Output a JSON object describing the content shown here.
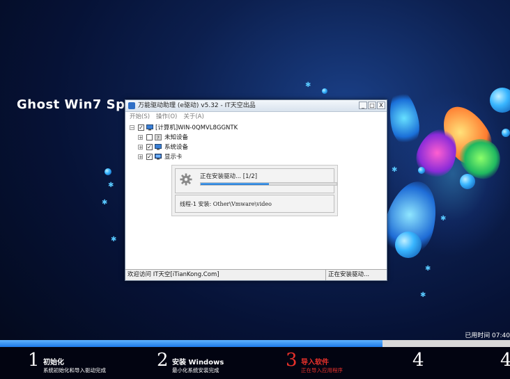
{
  "desktop": {
    "os_title": "Ghost Win7 Sp1 X"
  },
  "window": {
    "title": "万能驱动助理 (e驱动) v5.32 - IT天空出品",
    "buttons": {
      "minimize": "_",
      "maximize": "□",
      "close": "X"
    },
    "menu": [
      "开始(S)",
      "操作(O)",
      "关于(A)"
    ],
    "tree": {
      "root": "[计算机]WIN-0QMVL8GGNTK",
      "children": [
        "未知设备",
        "系统设备",
        "显示卡"
      ]
    },
    "progress": {
      "status": "正在安装驱动... [1/2]",
      "percent": 0.5,
      "thread_label": "线程-1 安装:",
      "thread_value": "Other\\Vmware\\video"
    },
    "statusbar": {
      "left": "欢迎访问 IT天空[iTianKong.Com]",
      "right": "正在安装驱动..."
    }
  },
  "elapsed": "已用时间 07:40",
  "overall_progress": 0.75,
  "steps": [
    {
      "num": "1",
      "title": "初始化",
      "sub": "系统初始化和导入驱动完成",
      "active": false
    },
    {
      "num": "2",
      "title": "安装 Windows",
      "sub": "最小化系统安装完成",
      "active": false
    },
    {
      "num": "3",
      "title": "导入软件",
      "sub": "正在导入应用程序",
      "active": true
    },
    {
      "num": "4",
      "title": "",
      "sub": "",
      "active": false
    },
    {
      "num": "4",
      "title": "",
      "sub": "",
      "active": false
    }
  ],
  "colors": {
    "accent": "#1f76d2",
    "active_step": "#e8312b"
  }
}
